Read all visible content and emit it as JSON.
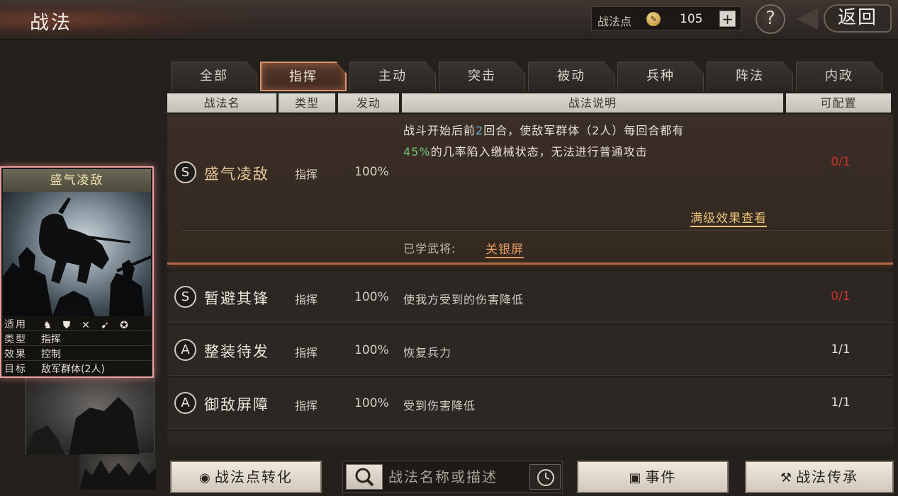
{
  "header": {
    "title": "战法",
    "points_label": "战法点",
    "points_value": "105",
    "points_add": "+",
    "help": "?",
    "back": "返回"
  },
  "tabs": [
    {
      "label": "全部",
      "active": false
    },
    {
      "label": "指挥",
      "active": true
    },
    {
      "label": "主动",
      "active": false
    },
    {
      "label": "突击",
      "active": false
    },
    {
      "label": "被动",
      "active": false
    },
    {
      "label": "兵种",
      "active": false
    },
    {
      "label": "阵法",
      "active": false
    },
    {
      "label": "内政",
      "active": false
    }
  ],
  "columns": {
    "name": "战法名",
    "type": "类型",
    "trigger": "发动",
    "desc": "战法说明",
    "config": "可配置"
  },
  "skills": [
    {
      "grade": "S",
      "name": "盛气凌敌",
      "type": "指挥",
      "rate": "100%",
      "desc_part1": "战斗开始后前",
      "desc_turns": "2",
      "desc_part2": "回合，使敌军群体（2人）每回合都有",
      "desc_pct": "45%",
      "desc_part3": "的几率陷入缴械状态，无法进行普通攻击",
      "config": "0/1",
      "max_level_link": "满级效果查看",
      "learned_label": "已学武将:",
      "learned_general": "关银屏"
    },
    {
      "grade": "S",
      "name": "暂避其锋",
      "type": "指挥",
      "rate": "100%",
      "desc": "使我方受到的伤害降低",
      "config": "0/1"
    },
    {
      "grade": "A",
      "name": "整装待发",
      "type": "指挥",
      "rate": "100%",
      "desc": "恢复兵力",
      "config": "1/1"
    },
    {
      "grade": "A",
      "name": "御敌屏障",
      "type": "指挥",
      "rate": "100%",
      "desc": "受到伤害降低",
      "config": "1/1"
    }
  ],
  "card": {
    "title": "盛气凌敌",
    "stats": {
      "apply_label": "适用",
      "type_label": "类型",
      "type_value": "指挥",
      "effect_label": "效果",
      "effect_value": "控制",
      "target_label": "目标",
      "target_value": "敌军群体(2人)"
    },
    "unit_icons": [
      "cavalry-icon",
      "shield-icon",
      "archer-icon",
      "spear-icon",
      "siege-icon"
    ]
  },
  "bottom": {
    "convert_label": "战法点转化",
    "search_placeholder": "战法名称或描述",
    "events_label": "事件",
    "inherit_label": "战法传承"
  },
  "colors": {
    "accent_orange": "#d89572",
    "config_red": "#c8332d",
    "highlight_blue": "#6fb3d6",
    "highlight_green": "#78c67a",
    "link_gold": "#e8c278"
  }
}
